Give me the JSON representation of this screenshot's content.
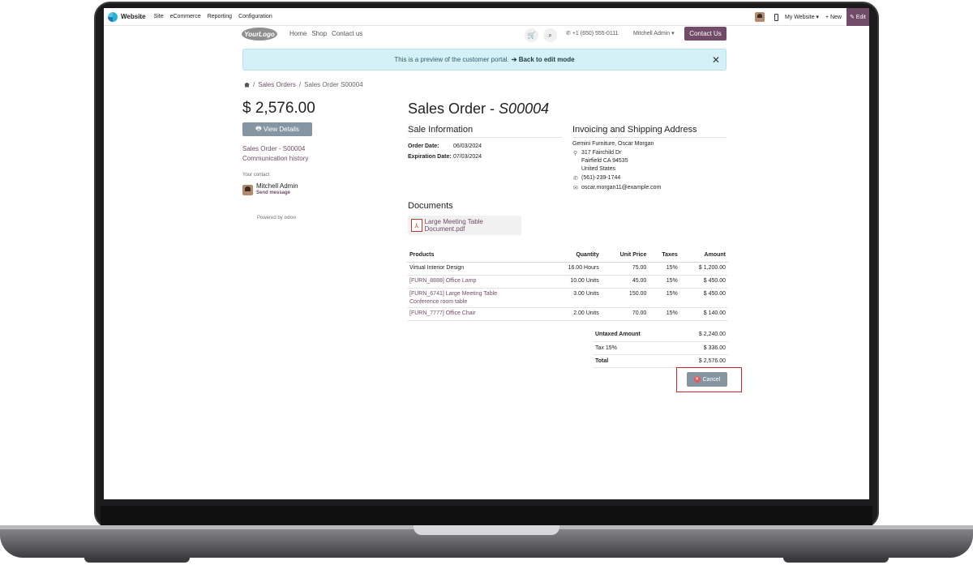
{
  "adminbar": {
    "app_name": "Website",
    "menus": [
      "Site",
      "eCommerce",
      "Reporting",
      "Configuration"
    ],
    "my_website": "My Website ▾",
    "new_label": "+ New",
    "edit_label": "✎ Edit"
  },
  "sitenav": {
    "logo_text": "YourLogo",
    "links": [
      "Home",
      "Shop",
      "Contact us"
    ],
    "phone": "+1 (650) 555-0111",
    "user": "Mitchell Admin",
    "contact_button": "Contact Us"
  },
  "alert": {
    "text": "This is a preview of the customer portal.",
    "link": "➔ Back to edit mode"
  },
  "breadcrumb": [
    "Sales Orders",
    "Sales Order S00004"
  ],
  "sidebar": {
    "amount": "$ 2,576.00",
    "view_details": "View Details",
    "links": [
      "Sales Order - S00004",
      "Communication history"
    ],
    "your_contact": "Your contact",
    "contact_name": "Mitchell Admin",
    "send_message": "Send message",
    "powered_by": "Powered by",
    "powered_brand": "odoo"
  },
  "order": {
    "title_prefix": "Sales Order - ",
    "number": "S00004",
    "sale_info_heading": "Sale Information",
    "order_date_label": "Order Date:",
    "order_date": "06/03/2024",
    "expiration_label": "Expiration Date:",
    "expiration_date": "07/03/2024",
    "address_heading": "Invoicing and Shipping Address",
    "customer": "Gemini Furniture, Oscar Morgan",
    "address_lines": [
      "317 Fairchild Dr",
      "Fairfield CA 94535",
      "United States"
    ],
    "phone": "(561)-239-1744",
    "email": "oscar.morgan11@example.com",
    "documents_heading": "Documents",
    "document": "Large Meeting Table Document.pdf"
  },
  "lines": {
    "headers": [
      "Products",
      "Quantity",
      "Unit Price",
      "Taxes",
      "Amount"
    ],
    "rows": [
      {
        "product": "Virtual Interior Design",
        "desc": "",
        "qty": "16.00 Hours",
        "price": "75.00",
        "tax": "15%",
        "amount": "$ 1,200.00"
      },
      {
        "product": "[FURN_8888] Office Lamp",
        "desc": "",
        "qty": "10.00 Units",
        "price": "45.00",
        "tax": "15%",
        "amount": "$ 450.00"
      },
      {
        "product": "[FURN_6741] Large Meeting Table",
        "desc": "Conference room table",
        "qty": "3.00 Units",
        "price": "150.00",
        "tax": "15%",
        "amount": "$ 450.00"
      },
      {
        "product": "[FURN_7777] Office Chair",
        "desc": "",
        "qty": "2.00 Units",
        "price": "70.00",
        "tax": "15%",
        "amount": "$ 140.00"
      }
    ]
  },
  "totals": {
    "untaxed_label": "Untaxed Amount",
    "untaxed": "$ 2,240.00",
    "tax_label": "Tax 15%",
    "tax": "$ 336.00",
    "total_label": "Total",
    "total": "$ 2,576.00"
  },
  "cancel_label": "Cancel",
  "colors": {
    "brand": "#714b67",
    "secondary_button": "#8595a2",
    "highlight_box": "#d1232a"
  }
}
